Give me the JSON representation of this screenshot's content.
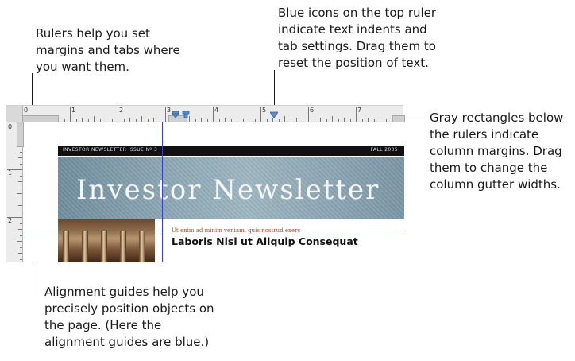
{
  "callouts": {
    "rulers": [
      "Rulers help you set",
      "margins and tabs where",
      "you want them."
    ],
    "blue_icons": [
      "Blue icons on the top ruler",
      "indicate text indents and",
      "tab settings. Drag them to",
      "reset the position of text."
    ],
    "gray_rects": [
      "Gray rectangles below",
      "the rulers indicate",
      "column margins. Drag",
      "them to change the",
      "column gutter widths."
    ],
    "guides": [
      "Alignment guides help you",
      "precisely position objects on",
      "the page. (Here the",
      "alignment guides are blue.)"
    ]
  },
  "ruler": {
    "top_numbers": [
      "0",
      "1",
      "2",
      "3",
      "4",
      "5",
      "6",
      "7"
    ],
    "left_numbers": [
      "0",
      "1",
      "2"
    ]
  },
  "newsletter": {
    "issue": "INVESTOR NEWSLETTER ISSUE Nº 3",
    "date": "FALL 2005",
    "title": "Investor Newsletter",
    "latin": "Ut enim ad minim veniam, quis nostrud exerc",
    "headline": "Laboris Nisi ut Aliquip Consequat"
  },
  "colors": {
    "guide": "#3b3bd6",
    "marker": "#5b8fd0",
    "banner": "#8fa9b6",
    "latin_text": "#b04a2a"
  },
  "icons": {
    "tab_markers": "blue-tab-marker-icon",
    "indent_marker": "blue-indent-marker-icon"
  }
}
